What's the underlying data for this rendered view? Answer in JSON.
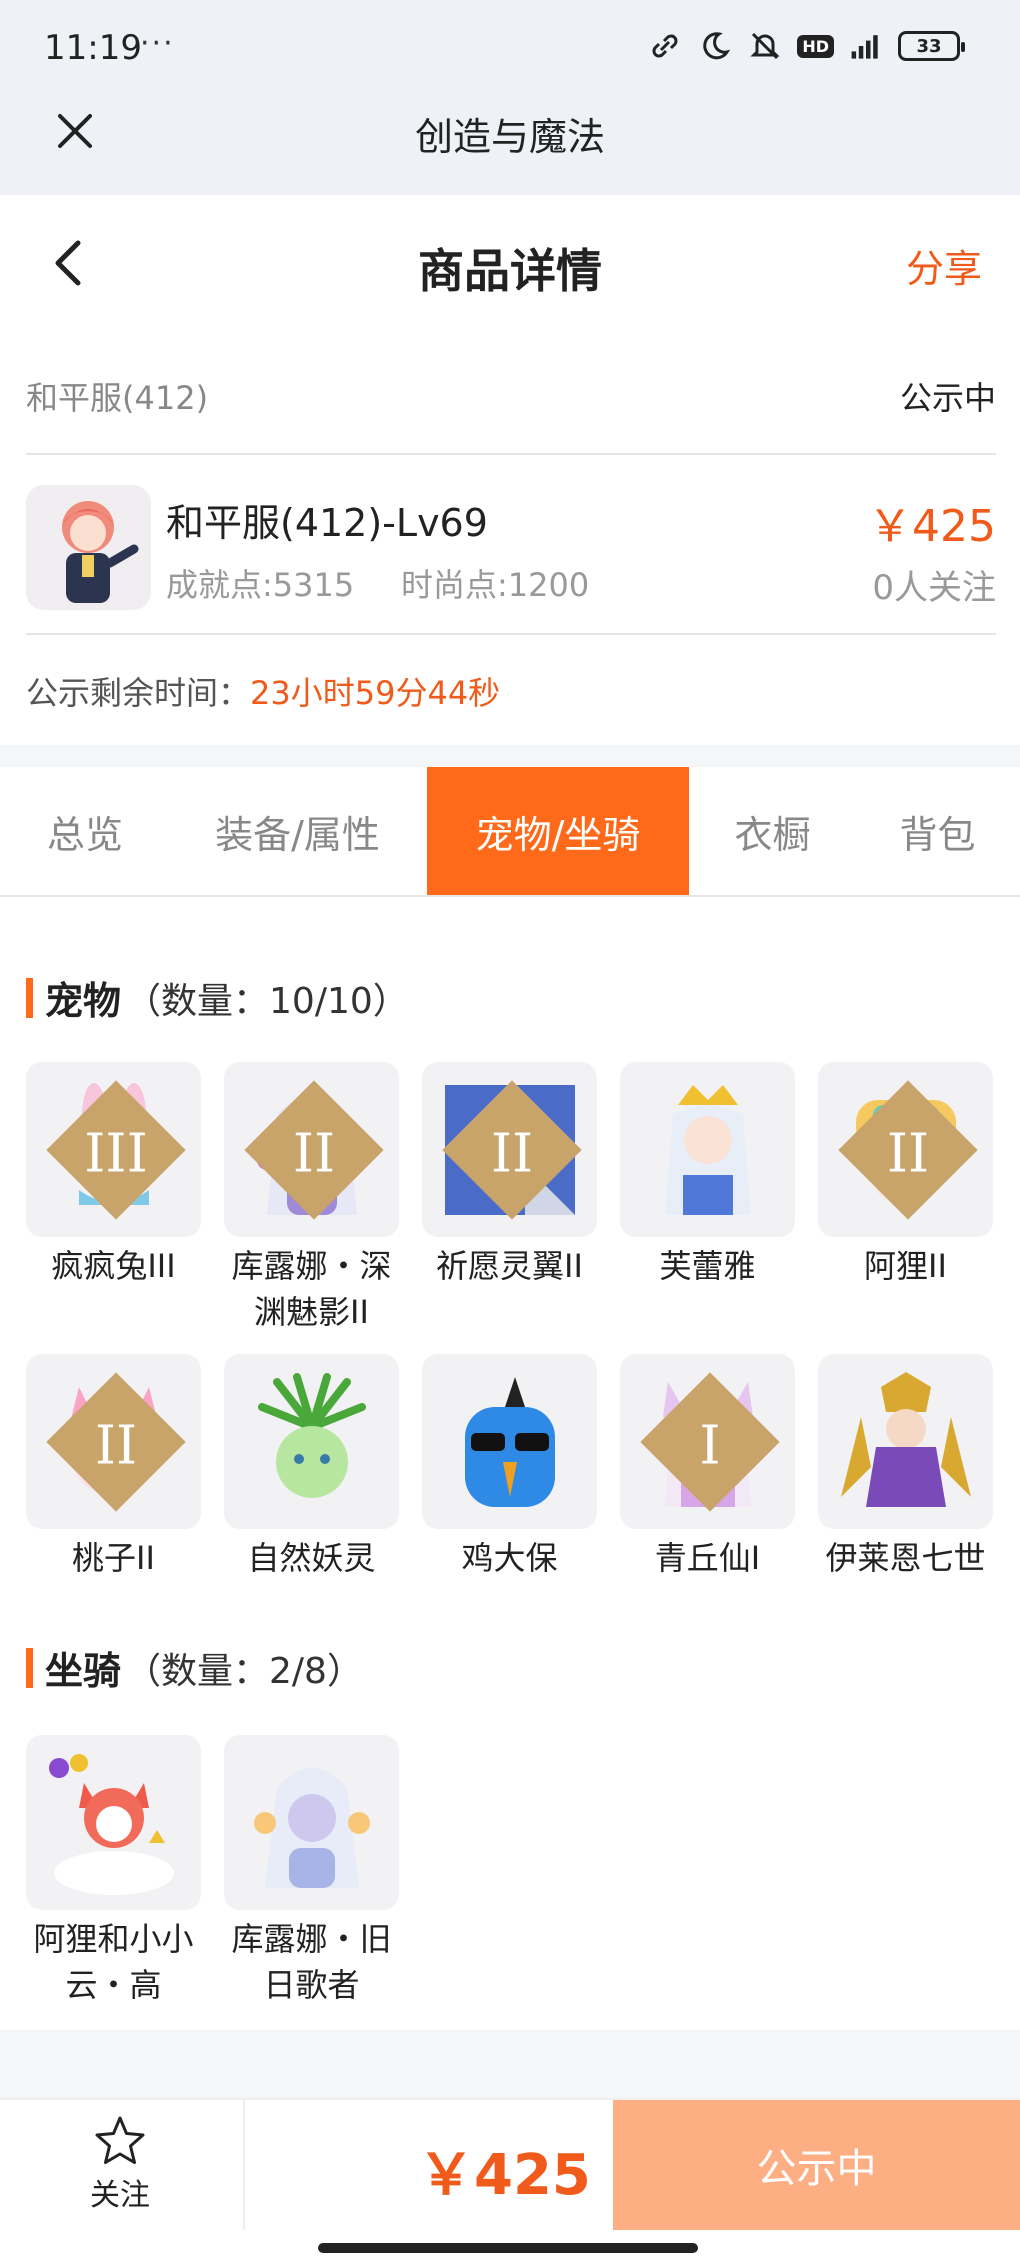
{
  "status_bar": {
    "time": "11:19",
    "dots": "···",
    "battery": "33",
    "hd": "HD"
  },
  "app": {
    "title": "创造与魔法"
  },
  "page": {
    "title": "商品详情",
    "share_label": "分享"
  },
  "server": {
    "name": "和平服(412)",
    "status": "公示中"
  },
  "product": {
    "name": "和平服(412)-Lv69",
    "achievement": "成就点:5315",
    "fashion": "时尚点:1200",
    "price": "￥425",
    "followers": "0人关注"
  },
  "countdown": {
    "label": "公示剩余时间：",
    "value": "23小时59分44秒"
  },
  "tabs": [
    {
      "label": "总览",
      "active": false
    },
    {
      "label": "装备/属性",
      "active": false
    },
    {
      "label": "宠物/坐骑",
      "active": true
    },
    {
      "label": "衣橱",
      "active": false
    },
    {
      "label": "背包",
      "active": false
    }
  ],
  "pets": {
    "title": "宠物",
    "count": "（数量：10/10）",
    "items": [
      {
        "name": "疯疯兔III",
        "rank": "III"
      },
      {
        "name": "库露娜・深渊魅影II",
        "rank": "II"
      },
      {
        "name": "祈愿灵翼II",
        "rank": "II"
      },
      {
        "name": "芙蕾雅",
        "rank": ""
      },
      {
        "name": "阿狸II",
        "rank": "II"
      },
      {
        "name": "桃子II",
        "rank": "II"
      },
      {
        "name": "自然妖灵",
        "rank": ""
      },
      {
        "name": "鸡大保",
        "rank": ""
      },
      {
        "name": "青丘仙I",
        "rank": "I"
      },
      {
        "name": "伊莱恩七世",
        "rank": ""
      }
    ]
  },
  "mounts": {
    "title": "坐骑",
    "count": "（数量：2/8）",
    "items": [
      {
        "name": "阿狸和小小云・高",
        "rank": ""
      },
      {
        "name": "库露娜・旧日歌者",
        "rank": ""
      }
    ]
  },
  "bottom_bar": {
    "follow_label": "关注",
    "price": "￥425",
    "status_button": "公示中"
  },
  "colors": {
    "accent": "#ff6a1a",
    "price": "#f05a1a",
    "status_button": "#fdae82"
  }
}
